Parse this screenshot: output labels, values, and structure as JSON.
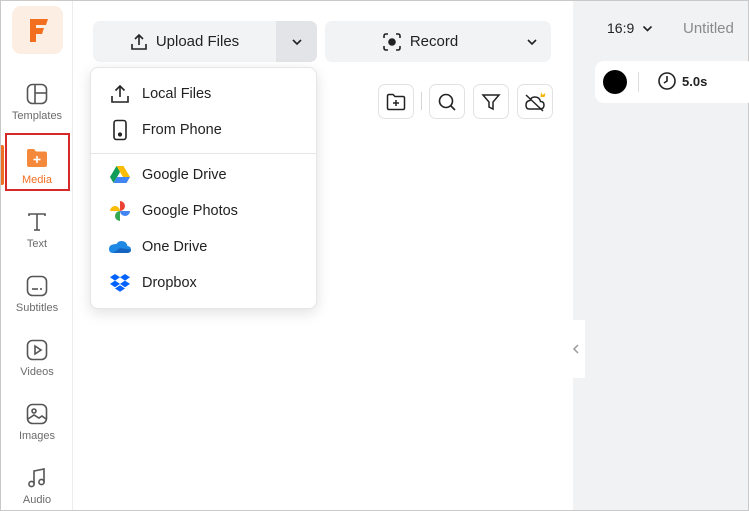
{
  "sidebar": {
    "items": [
      {
        "label": "Templates",
        "icon": "templates-icon"
      },
      {
        "label": "Media",
        "icon": "media-folder-icon",
        "active": true
      },
      {
        "label": "Text",
        "icon": "text-icon"
      },
      {
        "label": "Subtitles",
        "icon": "subtitles-icon"
      },
      {
        "label": "Videos",
        "icon": "videos-icon"
      },
      {
        "label": "Images",
        "icon": "images-icon"
      },
      {
        "label": "Audio",
        "icon": "audio-icon"
      }
    ]
  },
  "toolbar": {
    "upload_label": "Upload Files",
    "record_label": "Record"
  },
  "upload_menu": {
    "items": [
      {
        "label": "Local Files",
        "icon": "upload-icon"
      },
      {
        "label": "From Phone",
        "icon": "phone-icon"
      },
      {
        "label": "Google Drive",
        "icon": "google-drive-icon"
      },
      {
        "label": "Google Photos",
        "icon": "google-photos-icon"
      },
      {
        "label": "One Drive",
        "icon": "onedrive-icon"
      },
      {
        "label": "Dropbox",
        "icon": "dropbox-icon"
      }
    ]
  },
  "media_tools": [
    "new-folder-icon",
    "search-icon",
    "filter-icon",
    "cloud-off-premium-icon"
  ],
  "right_panel": {
    "aspect_ratio": "16:9",
    "title": "Untitled",
    "duration": "5.0s",
    "background_color": "#000000"
  },
  "colors": {
    "accent": "#f07022",
    "highlight_outline": "#d42a2a"
  }
}
